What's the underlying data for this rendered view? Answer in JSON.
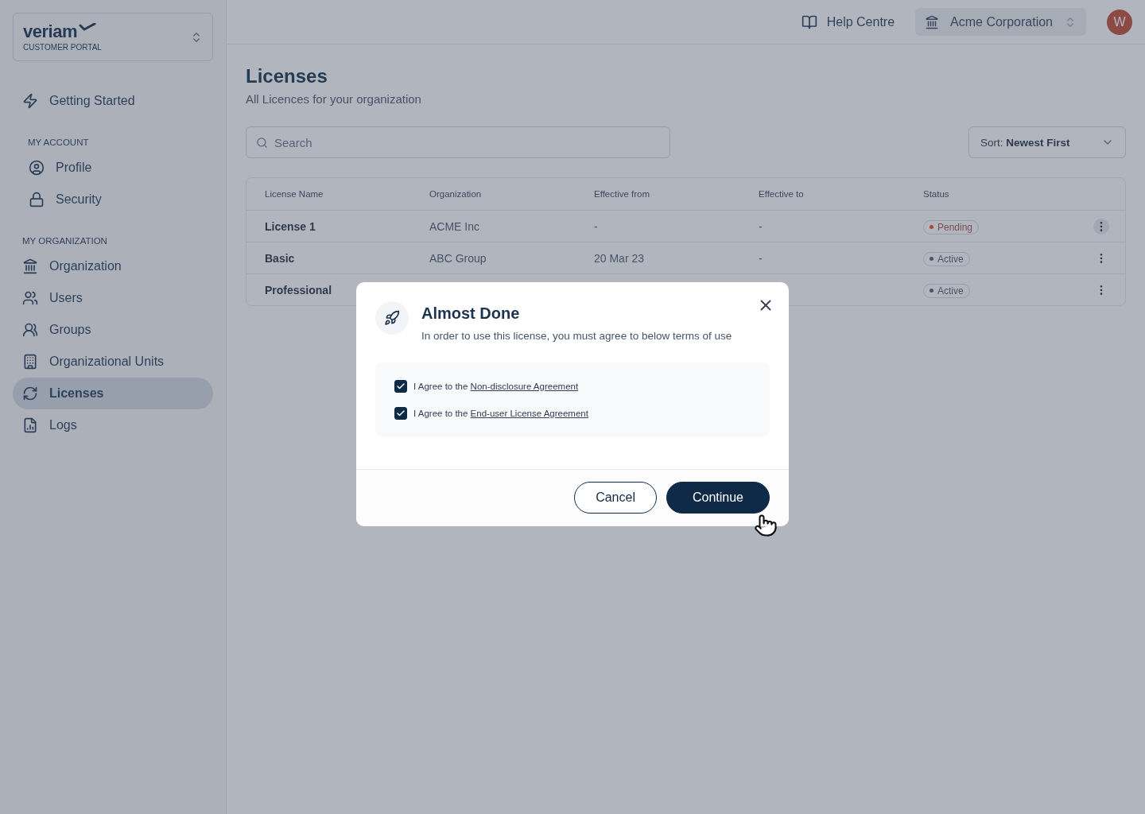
{
  "brand": {
    "name": "veriam",
    "subtitle": "CUSTOMER PORTAL"
  },
  "sidebar": {
    "top_item": {
      "label": "Getting Started",
      "selected": false
    },
    "sections": [
      {
        "title": "MY ACCOUNT",
        "items": [
          {
            "label": "Profile",
            "selected": false
          },
          {
            "label": "Security",
            "selected": false
          }
        ]
      },
      {
        "title": "MY ORGANIZATION",
        "items": [
          {
            "label": "Organization",
            "selected": false
          },
          {
            "label": "Users",
            "selected": false
          },
          {
            "label": "Groups",
            "selected": false
          },
          {
            "label": "Organizational Units",
            "selected": false
          },
          {
            "label": "Licenses",
            "selected": true
          },
          {
            "label": "Logs",
            "selected": false
          }
        ]
      }
    ]
  },
  "topbar": {
    "help": "Help Centre",
    "organization": "Acme Corporation",
    "avatar": "W"
  },
  "page": {
    "title": "Licenses",
    "subtitle": "All Licences for your organization"
  },
  "search": {
    "placeholder": "Search"
  },
  "sort": {
    "label": "Sort: **Newest First**"
  },
  "table": {
    "columns": [
      "License Name",
      "Organization",
      "Effective from",
      "Effective to",
      "Status"
    ],
    "rows": [
      {
        "cells": [
          "License 1",
          "ACME Inc",
          "-",
          "-"
        ],
        "status": "Pending",
        "color": "#a94a3c"
      },
      {
        "cells": [
          "Basic",
          "ABC Group",
          "20 Mar 23",
          "-"
        ],
        "status": "Active",
        "color": "#4a5568"
      },
      {
        "cells": [
          "Professional"
        ],
        "status": "Active",
        "color": "#4a5568"
      }
    ]
  },
  "dialog": {
    "title": "Almost Done",
    "message": "In order to use this license, you must agree to below terms of use",
    "agreements": [
      {
        "text": "I Agree to the ",
        "link": "Non-disclosure Agreement",
        "checked": true
      },
      {
        "text": "I Agree to the ",
        "link": "End-user License Agreement",
        "checked": true
      }
    ],
    "buttons": {
      "cancel": "Cancel",
      "confirm": "Continue"
    }
  }
}
